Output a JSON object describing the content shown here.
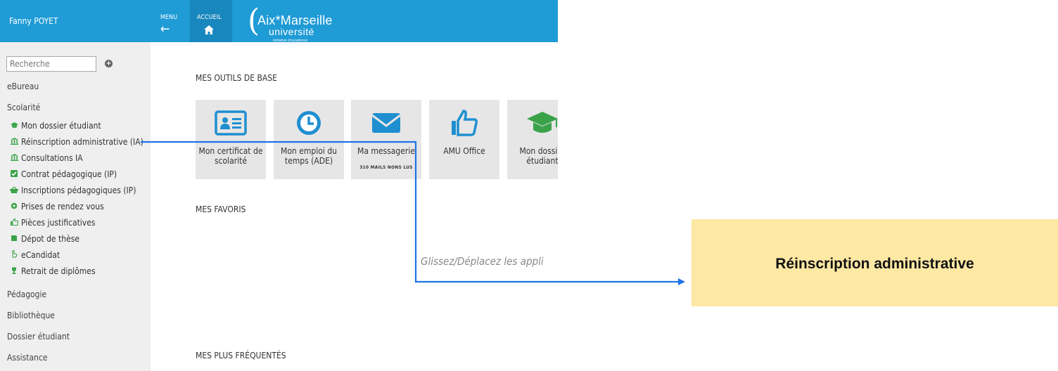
{
  "sidebar": {
    "user_name": "Fanny POYET",
    "search_placeholder": "Recherche",
    "add_icon": "+",
    "sections": {
      "ebureau": "eBureau",
      "scolarite": "Scolarité",
      "pedagogie": "Pédagogie",
      "bibliotheque": "Bibliothèque",
      "dossier": "Dossier étudiant",
      "assistance": "Assistance"
    },
    "scolarite_items": [
      {
        "label": "Mon dossier étudiant",
        "icon": "graduation-cap-icon",
        "color": "#3aa34a"
      },
      {
        "label": "Réinscription administrative (IA)",
        "icon": "institution-icon",
        "color": "#3aa34a"
      },
      {
        "label": "Consultations IA",
        "icon": "institution-icon",
        "color": "#3aa34a"
      },
      {
        "label": "Contrat pédagogique (IP)",
        "icon": "checkbox-icon",
        "color": "#3aa34a"
      },
      {
        "label": "Inscriptions pédagogiques (IP)",
        "icon": "basket-icon",
        "color": "#3aa34a"
      },
      {
        "label": "Prises de rendez vous",
        "icon": "gear-icon",
        "color": "#3aa34a"
      },
      {
        "label": "Pièces justificatives",
        "icon": "thumbs-up-icon",
        "color": "#3aa34a"
      },
      {
        "label": "Dépot de thèse",
        "icon": "book-icon",
        "color": "#3aa34a"
      },
      {
        "label": "eCandidat",
        "icon": "hand-icon",
        "color": "#3aa34a"
      },
      {
        "label": "Retrait de diplômes",
        "icon": "trophy-icon",
        "color": "#3aa34a"
      }
    ]
  },
  "topbar": {
    "menu_label": "MENU",
    "home_label": "ACCUEIL",
    "logo_title": "Aix*Marseille",
    "logo_sub": "université",
    "logo_tag": "Initiative d'excellence",
    "brand_color": "#1f9bd6"
  },
  "main": {
    "tools_title": "MES OUTILS DE BASE",
    "tiles": [
      {
        "label": "Mon certificat de scolarité",
        "icon": "id-card-icon",
        "sub": ""
      },
      {
        "label": "Mon emploi du temps (ADE)",
        "icon": "clock-icon",
        "sub": ""
      },
      {
        "label": "Ma messagerie",
        "icon": "envelope-icon",
        "sub": "310 Mails nons lus"
      },
      {
        "label": "AMU Office",
        "icon": "thumbs-up-icon",
        "sub": ""
      },
      {
        "label": "Mon dossier étudiant",
        "icon": "graduation-cap-icon",
        "sub": ""
      }
    ],
    "favorites_title": "MES FAVORIS",
    "drop_hint": "Glissez/Déplacez les appli",
    "frequent_title": "MES PLUS FRÉQUENTÉS"
  },
  "callout": {
    "text": "Réinscription administrative"
  }
}
